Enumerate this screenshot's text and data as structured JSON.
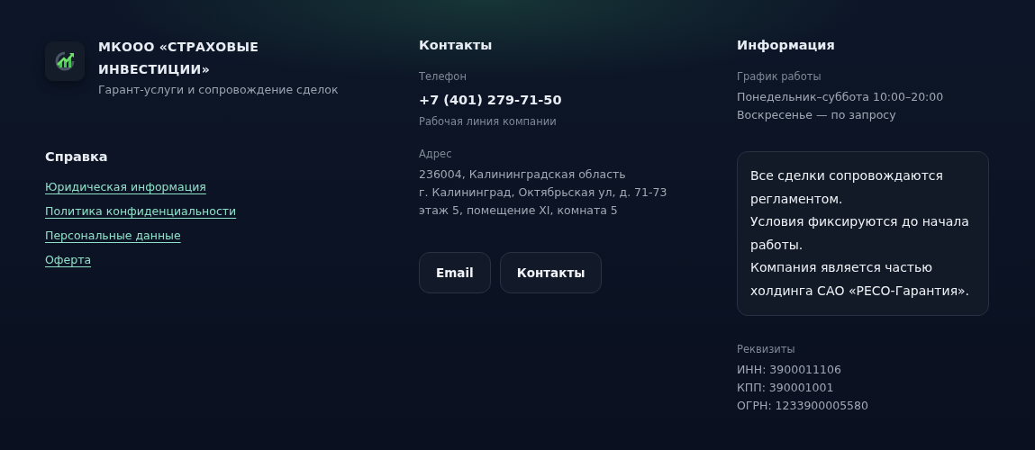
{
  "brand": {
    "name": "МКООО «СТРАХОВЫЕ ИНВЕСТИЦИИ»",
    "tagline": "Гарант-услуги и сопровождение сделок"
  },
  "help": {
    "title": "Справка",
    "links": [
      "Юридическая информация",
      "Политика конфиденциальности",
      "Персональные данные",
      "Оферта"
    ]
  },
  "contacts": {
    "title": "Контакты",
    "phone_label": "Телефон",
    "phone": "+7 (401) 279-71-50",
    "phone_note": "Рабочая линия компании",
    "address_label": "Адрес",
    "address_lines": [
      "236004, Калининградская область",
      "г. Калининград, Октябрьская ул, д. 71-73",
      "этаж 5, помещение XI, комната 5"
    ],
    "buttons": [
      "Email",
      "Контакты"
    ]
  },
  "info": {
    "title": "Информация",
    "schedule_label": "График работы",
    "schedule_lines": [
      "Понедельник–суббота 10:00–20:00",
      "Воскресенье — по запросу"
    ],
    "notice": [
      "Все сделки сопровождаются регламентом.",
      "Условия фиксируются до начала работы.",
      "Компания является частью холдинга САО «РЕСО-Гарантия»."
    ],
    "requisites_label": "Реквизиты",
    "requisites": [
      "ИНН: 3900011106",
      "КПП: 390001001",
      "ОГРН: 1233900005580"
    ]
  }
}
